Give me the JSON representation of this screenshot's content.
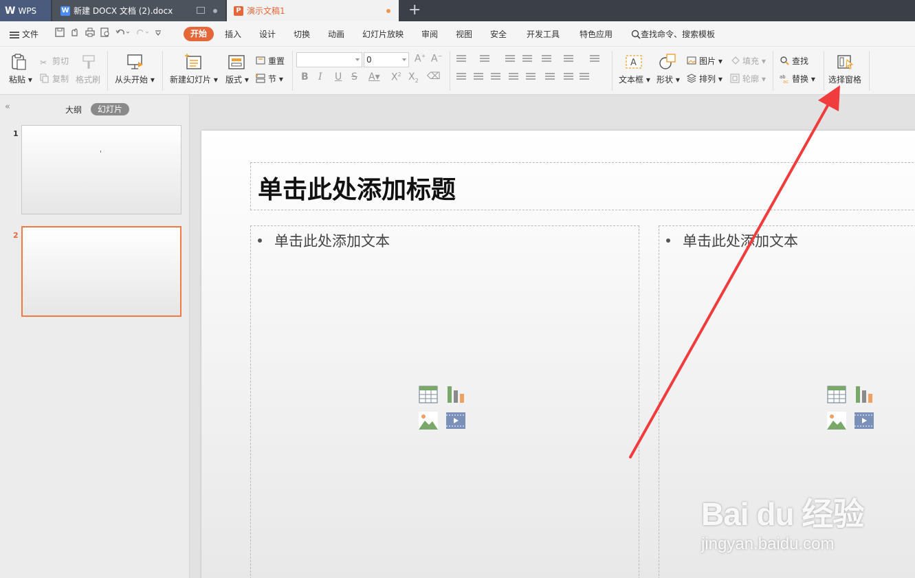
{
  "tabs": {
    "wps": "WPS",
    "doc": "新建 DOCX 文档 (2).docx",
    "ppt": "演示文稿1",
    "add": "+"
  },
  "menu": {
    "file": "文件",
    "items": [
      "开始",
      "插入",
      "设计",
      "切换",
      "动画",
      "幻灯片放映",
      "审阅",
      "视图",
      "安全",
      "开发工具",
      "特色应用",
      "查找命令、搜索模板"
    ]
  },
  "ribbon": {
    "paste": "粘贴",
    "cut": "剪切",
    "copy": "复制",
    "format_painter": "格式刷",
    "from_start": "从头开始",
    "new_slide": "新建幻灯片",
    "layout": "版式",
    "reset": "重置",
    "section": "节",
    "font_size": "0",
    "text_box": "文本框",
    "shape": "形状",
    "picture": "图片",
    "fill": "填充",
    "arrange": "排列",
    "outline": "轮廓",
    "find": "查找",
    "replace": "替换",
    "selection_pane": "选择窗格"
  },
  "left_panel": {
    "outline_tab": "大纲",
    "slides_tab": "幻灯片",
    "thumbs": [
      {
        "num": "1"
      },
      {
        "num": "2"
      }
    ]
  },
  "slide": {
    "title_placeholder": "单击此处添加标题",
    "left_body": "单击此处添加文本",
    "right_body": "单击此处添加文本"
  },
  "watermark": {
    "brand": "Bai du 经验",
    "url": "jingyan.baidu.com"
  },
  "colors": {
    "accent": "#e4673a",
    "arrow": "#f03c3c",
    "tab_bar": "#3b3f47"
  }
}
